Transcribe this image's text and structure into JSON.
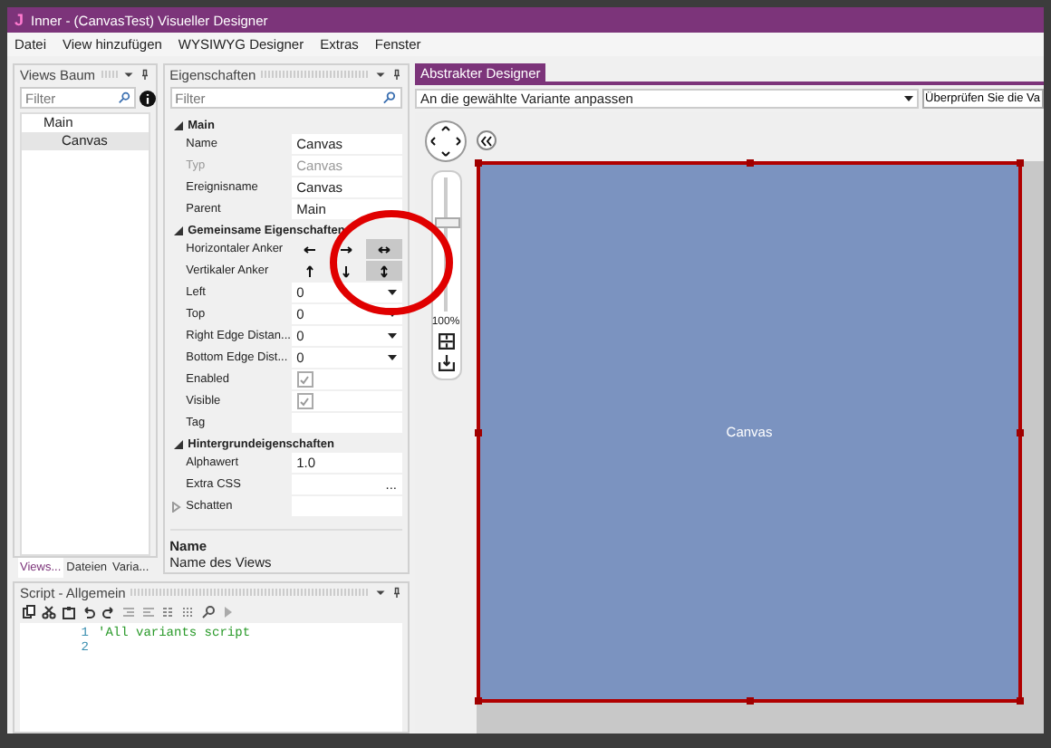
{
  "window": {
    "logo": "J",
    "title": "Inner - (CanvasTest) Visueller Designer"
  },
  "menu": [
    "Datei",
    "View hinzufügen",
    "WYSIWYG Designer",
    "Extras",
    "Fenster"
  ],
  "views_panel": {
    "title": "Views Baum",
    "filter_placeholder": "Filter",
    "tree": [
      {
        "label": "Main",
        "selected": false,
        "children": [
          {
            "label": "Canvas",
            "selected": true
          }
        ]
      }
    ],
    "tabs": [
      {
        "label": "Views...",
        "selected": true
      },
      {
        "label": "Dateien",
        "selected": false
      },
      {
        "label": "Varia...",
        "selected": false
      }
    ]
  },
  "properties_panel": {
    "title": "Eigenschaften",
    "filter_placeholder": "Filter",
    "groups": [
      {
        "title": "Main",
        "expanded": true,
        "rows": [
          {
            "kind": "text",
            "name": "Name",
            "value": "Canvas"
          },
          {
            "kind": "text",
            "name": "Typ",
            "value": "Canvas",
            "disabled": true
          },
          {
            "kind": "text",
            "name": "Ereignisname",
            "value": "Canvas"
          },
          {
            "kind": "text",
            "name": "Parent",
            "value": "Main"
          }
        ]
      },
      {
        "title": "Gemeinsame Eigenschaften",
        "expanded": true,
        "rows": [
          {
            "kind": "h-anchor",
            "name": "Horizontaler Anker",
            "options": [
              {
                "selected": false
              },
              {
                "selected": false
              },
              {
                "selected": true
              }
            ]
          },
          {
            "kind": "v-anchor",
            "name": "Vertikaler Anker",
            "options": [
              {
                "selected": false
              },
              {
                "selected": false
              },
              {
                "selected": true
              }
            ]
          },
          {
            "kind": "dropdown",
            "name": "Left",
            "value": "0"
          },
          {
            "kind": "dropdown",
            "name": "Top",
            "value": "0"
          },
          {
            "kind": "dropdown",
            "name": "Right Edge Distan...",
            "value": "0"
          },
          {
            "kind": "dropdown",
            "name": "Bottom Edge Dist...",
            "value": "0"
          },
          {
            "kind": "checkbox",
            "name": "Enabled",
            "checked": true
          },
          {
            "kind": "checkbox",
            "name": "Visible",
            "checked": true
          },
          {
            "kind": "text",
            "name": "Tag"
          }
        ]
      },
      {
        "title": "Hintergrundeigenschaften",
        "expanded": true,
        "rows": [
          {
            "kind": "text",
            "name": "Alphawert",
            "value": "1.0"
          },
          {
            "kind": "ellipsis",
            "name": "Extra CSS",
            "value": "..."
          },
          {
            "kind": "expander",
            "name": "Schatten",
            "expanded": false
          }
        ]
      }
    ],
    "description": {
      "title": "Name",
      "text": "Name des Views"
    }
  },
  "script_panel": {
    "title": "Script - Allgemein",
    "lines": [
      {
        "number": "1",
        "code": "'All variants script"
      },
      {
        "number": "2"
      }
    ]
  },
  "designer": {
    "tab": {
      "label": "Abstrakter Designer",
      "selected": true
    },
    "variant_dropdown": "An die gewählte Variante anpassen",
    "check_button": "Überprüfen Sie die Va",
    "zoom": {
      "level": 0.67,
      "reading": "100%"
    },
    "canvas": {
      "label": "Canvas"
    }
  }
}
